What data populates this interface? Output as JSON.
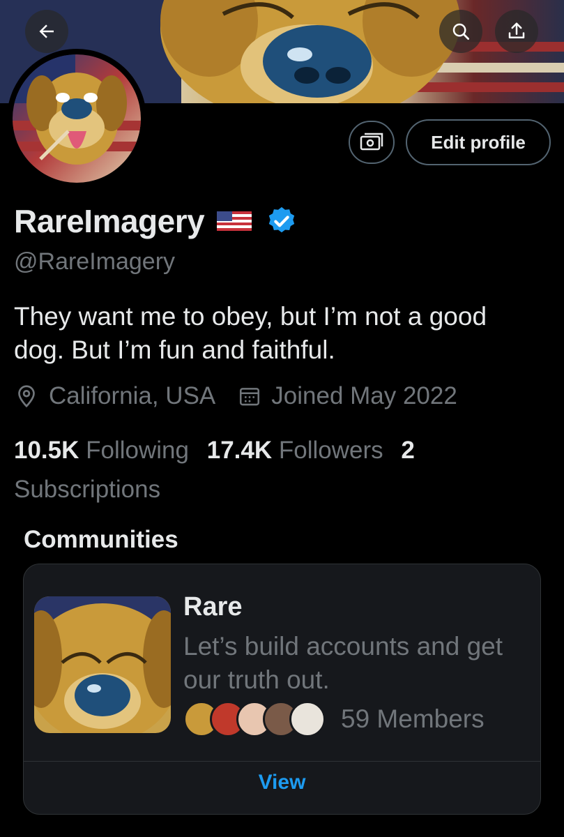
{
  "header": {
    "back_icon": "arrow-left-icon",
    "search_icon": "search-icon",
    "share_icon": "share-icon"
  },
  "profile": {
    "display_name": "RareImagery",
    "handle": "@RareImagery",
    "flag_icon": "us-flag-icon",
    "verified_icon": "verified-badge-icon",
    "verified_color": "#1d9bf0",
    "bio": "They want me to obey, but I’m not a good dog. But I’m fun and faithful.",
    "location": "California, USA",
    "joined": "Joined May 2022"
  },
  "actions": {
    "money_icon": "money-icon",
    "edit_label": "Edit profile"
  },
  "stats": {
    "following_count": "10.5K",
    "following_label": "Following",
    "followers_count": "17.4K",
    "followers_label": "Followers",
    "subscriptions_count": "2",
    "subscriptions_label": "Subscriptions"
  },
  "communities": {
    "heading": "Communities",
    "card": {
      "name": "Rare",
      "description": "Let’s build accounts and get our truth out.",
      "members_label": "59 Members",
      "view_label": "View"
    }
  },
  "colors": {
    "background": "#000000",
    "text_primary": "#e7e9ea",
    "text_secondary": "#71767b",
    "accent": "#1d9bf0",
    "card_bg": "#16181c",
    "border": "#536471"
  }
}
